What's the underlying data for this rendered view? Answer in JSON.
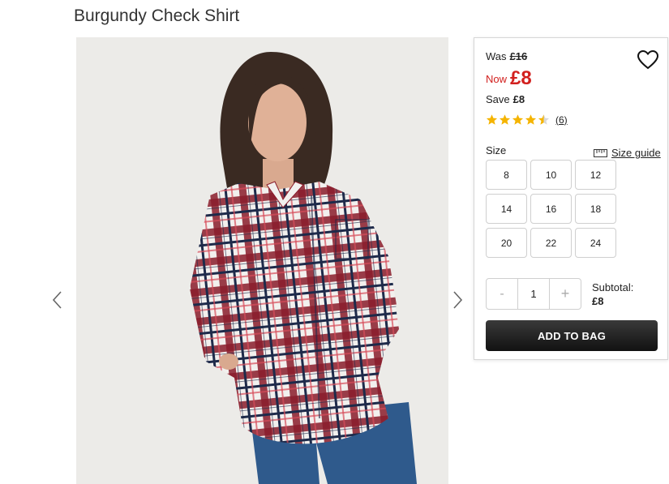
{
  "product": {
    "title": "Burgundy Check Shirt"
  },
  "pricing": {
    "was_label": "Was",
    "was_price": "£16",
    "now_label": "Now",
    "now_price": "£8",
    "save_label": "Save",
    "save_amount": "£8"
  },
  "rating": {
    "stars": 4.5,
    "review_count": "(6)"
  },
  "size": {
    "label": "Size",
    "guide_label": "Size guide",
    "options": [
      "8",
      "10",
      "12",
      "14",
      "16",
      "18",
      "20",
      "22",
      "24"
    ]
  },
  "quantity": {
    "minus": "-",
    "value": "1",
    "plus": "+"
  },
  "subtotal": {
    "label": "Subtotal:",
    "amount": "£8"
  },
  "cart": {
    "add_label": "ADD TO BAG"
  },
  "icons": {
    "prev": "chevron-left-icon",
    "next": "chevron-right-icon",
    "wishlist": "heart-icon",
    "star": "star-icon",
    "ruler": "ruler-icon"
  },
  "colors": {
    "sale_red": "#d2201e",
    "star_gold": "#f5b400",
    "button_dark": "#1f1f1f"
  }
}
